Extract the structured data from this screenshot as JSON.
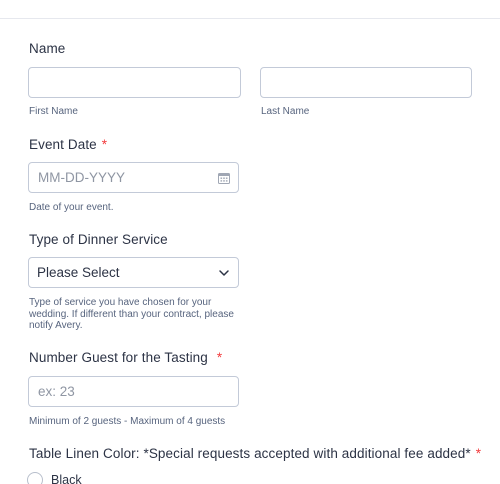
{
  "name_field": {
    "label": "Name",
    "first_sublabel": "First Name",
    "last_sublabel": "Last Name",
    "first_value": "",
    "last_value": ""
  },
  "event_date": {
    "label": "Event Date",
    "required_mark": "*",
    "placeholder": "MM-DD-YYYY",
    "sublabel": "Date of your event.",
    "icon": "calendar-icon"
  },
  "dinner_service": {
    "label": "Type of Dinner Service",
    "selected": "Please Select",
    "sublabel_lines": [
      "Type of service you have chosen for your",
      "wedding. If different than your contract, please",
      "notify Avery."
    ],
    "icon": "chevron-down-icon"
  },
  "guest_tasting": {
    "label": "Number Guest for the Tasting",
    "required_mark": "*",
    "placeholder": "ex: 23",
    "sublabel": "Minimum of 2 guests - Maximum of 4 guests"
  },
  "linen_color": {
    "label": "Table Linen Color: *Special requests accepted with additional fee added*",
    "required_mark": "*",
    "options": [
      "Black"
    ]
  },
  "colors": {
    "required": "#f23a3c",
    "border": "#c3cad8",
    "text": "#2c3345",
    "sublabel": "#57647e",
    "placeholder": "#8f96a3"
  }
}
